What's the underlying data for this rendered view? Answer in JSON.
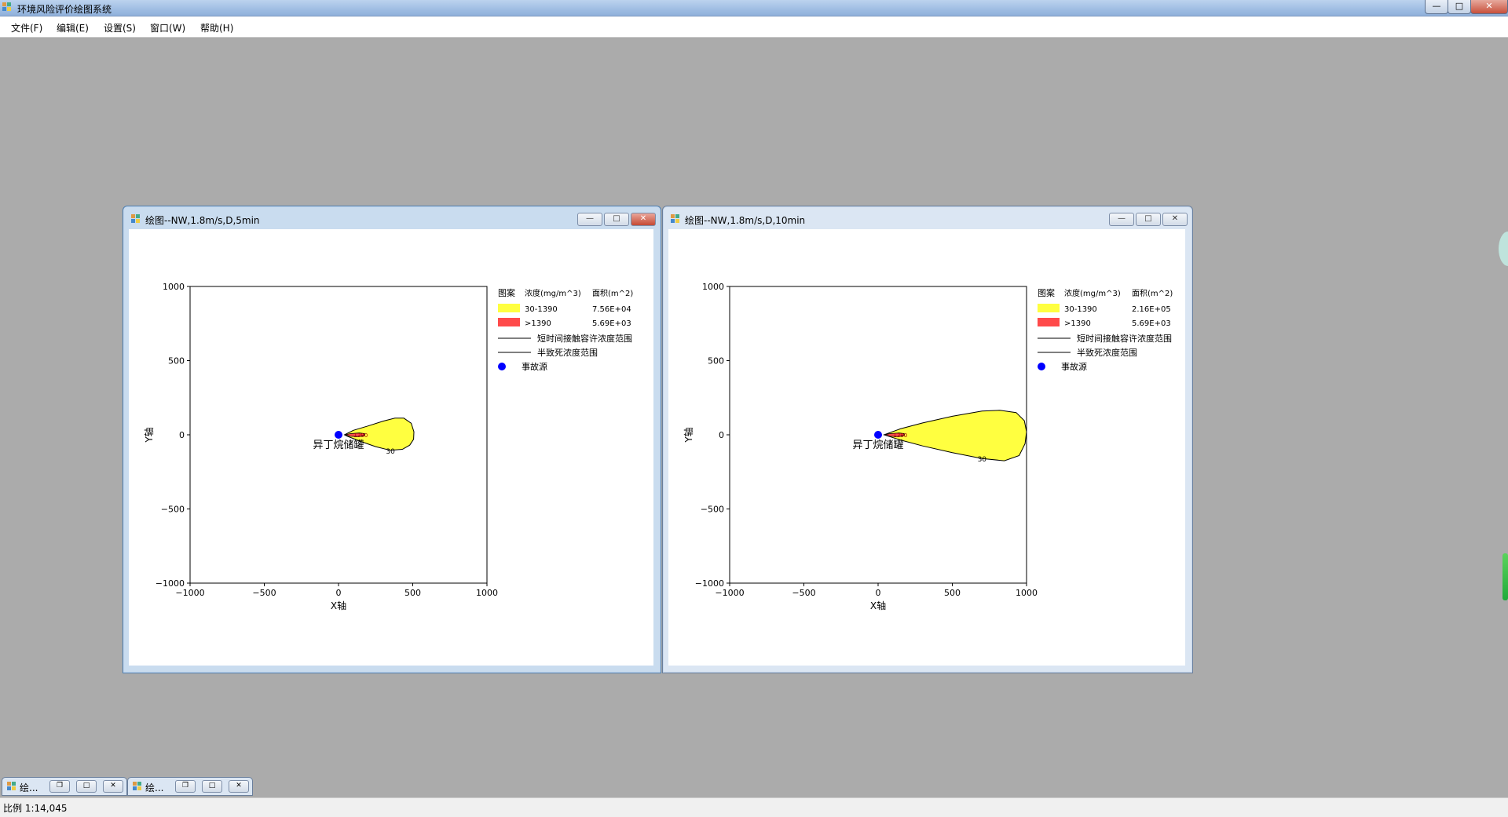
{
  "app": {
    "title": "环境风险评价绘图系统",
    "window_buttons": [
      "—",
      "□",
      "✕"
    ]
  },
  "menu": {
    "items": [
      "文件(F)",
      "编辑(E)",
      "设置(S)",
      "窗口(W)",
      "帮助(H)"
    ]
  },
  "windows": [
    {
      "title": "绘图--NW,1.8m/s,D,5min",
      "buttons": [
        "—",
        "□",
        "✕"
      ],
      "legend": {
        "headers": [
          "图案",
          "浓度(mg/m^3)",
          "面积(m^2)"
        ],
        "rows": [
          {
            "range": "30-1390",
            "area": "7.56E+04",
            "color": "#ffff40"
          },
          {
            "range": ">1390",
            "area": "5.69E+03",
            "color": "#ff4a4a"
          }
        ],
        "lines": [
          "短时间接触容许浓度范围",
          "半致死浓度范围"
        ],
        "point_label": "事故源",
        "point_color": "#0000ff"
      },
      "chart_data": {
        "type": "contour",
        "xlabel": "X轴",
        "ylabel": "Y轴",
        "xlim": [
          -1000,
          1000
        ],
        "ylim": [
          -1000,
          1000
        ],
        "xticks": [
          "−1000",
          "−500",
          "0",
          "500",
          "1000"
        ],
        "yticks": [
          "1000",
          "500",
          "0",
          "−500",
          "−1000"
        ],
        "source_label": "异丁烷储罐",
        "source": {
          "x": 0,
          "y": 0
        },
        "contour_labels": [
          "30",
          "1390"
        ],
        "plume_outer": [
          [
            40,
            0
          ],
          [
            100,
            30
          ],
          [
            200,
            60
          ],
          [
            300,
            92
          ],
          [
            380,
            112
          ],
          [
            440,
            112
          ],
          [
            490,
            78
          ],
          [
            508,
            20
          ],
          [
            506,
            -30
          ],
          [
            480,
            -70
          ],
          [
            430,
            -98
          ],
          [
            350,
            -105
          ],
          [
            250,
            -80
          ],
          [
            150,
            -45
          ],
          [
            60,
            -10
          ],
          [
            40,
            0
          ]
        ],
        "plume_inner": [
          [
            45,
            0
          ],
          [
            80,
            8
          ],
          [
            140,
            12
          ],
          [
            175,
            8
          ],
          [
            175,
            -5
          ],
          [
            140,
            -12
          ],
          [
            80,
            -10
          ],
          [
            45,
            0
          ]
        ]
      }
    },
    {
      "title": "绘图--NW,1.8m/s,D,10min",
      "buttons": [
        "—",
        "□",
        "✕"
      ],
      "legend": {
        "headers": [
          "图案",
          "浓度(mg/m^3)",
          "面积(m^2)"
        ],
        "rows": [
          {
            "range": "30-1390",
            "area": "2.16E+05",
            "color": "#ffff40"
          },
          {
            "range": ">1390",
            "area": "5.69E+03",
            "color": "#ff4a4a"
          }
        ],
        "lines": [
          "短时间接触容许浓度范围",
          "半致死浓度范围"
        ],
        "point_label": "事故源",
        "point_color": "#0000ff"
      },
      "chart_data": {
        "type": "contour",
        "xlabel": "X轴",
        "ylabel": "Y轴",
        "xlim": [
          -1000,
          1000
        ],
        "ylim": [
          -1000,
          1000
        ],
        "xticks": [
          "−1000",
          "−500",
          "0",
          "500",
          "1000"
        ],
        "yticks": [
          "1000",
          "500",
          "0",
          "−500",
          "−1000"
        ],
        "source_label": "异丁烷储罐",
        "source": {
          "x": 0,
          "y": 0
        },
        "contour_labels": [
          "30",
          "1390"
        ],
        "plume_outer": [
          [
            40,
            0
          ],
          [
            150,
            40
          ],
          [
            300,
            80
          ],
          [
            500,
            125
          ],
          [
            700,
            160
          ],
          [
            820,
            165
          ],
          [
            930,
            150
          ],
          [
            985,
            95
          ],
          [
            1000,
            20
          ],
          [
            990,
            -60
          ],
          [
            950,
            -140
          ],
          [
            850,
            -175
          ],
          [
            700,
            -160
          ],
          [
            500,
            -120
          ],
          [
            300,
            -75
          ],
          [
            150,
            -35
          ],
          [
            40,
            0
          ]
        ],
        "plume_inner": [
          [
            45,
            0
          ],
          [
            80,
            8
          ],
          [
            140,
            12
          ],
          [
            175,
            8
          ],
          [
            175,
            -5
          ],
          [
            140,
            -12
          ],
          [
            80,
            -10
          ],
          [
            45,
            0
          ]
        ]
      }
    }
  ],
  "taskbar_minimized": [
    {
      "label": "绘..."
    },
    {
      "label": "绘..."
    }
  ],
  "status": {
    "text": "比例 1:14,045"
  }
}
